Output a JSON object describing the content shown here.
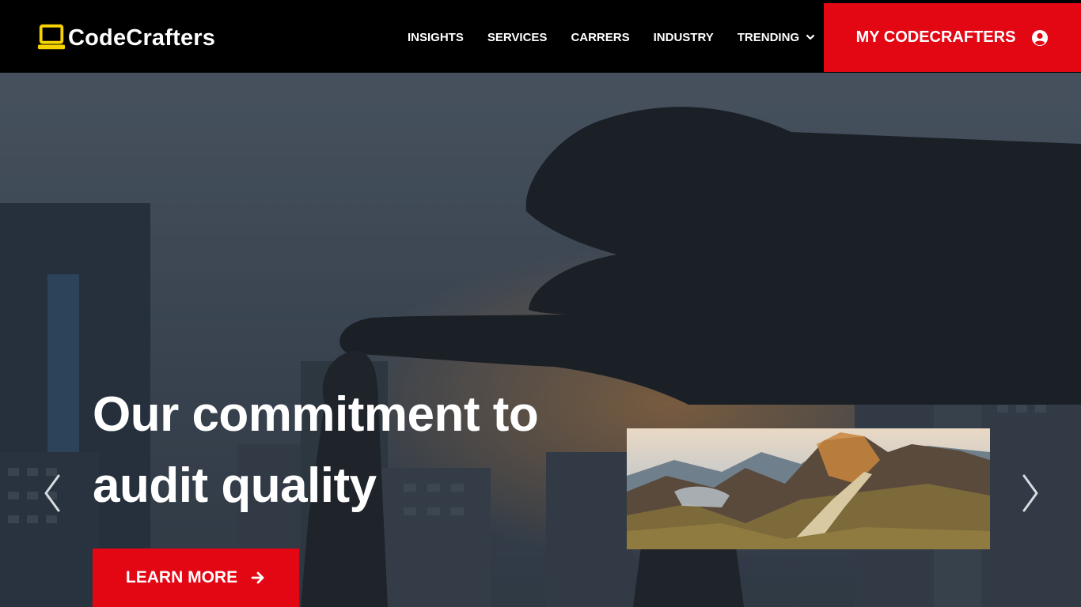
{
  "brand": {
    "name": "CodeCrafters",
    "icon": "laptop-icon",
    "icon_color": "#f5d300"
  },
  "nav": {
    "items": [
      {
        "label": "INSIGHTS"
      },
      {
        "label": "SERVICES"
      },
      {
        "label": "CARRERS"
      },
      {
        "label": "INDUSTRY"
      },
      {
        "label": "TRENDING",
        "icon": "chevron-down-icon"
      }
    ],
    "account": {
      "label": "MY CODECRAFTERS",
      "icon": "user-circle-icon"
    }
  },
  "hero": {
    "headline": "Our commitment to audit quality",
    "cta": {
      "label": "LEARN MORE",
      "icon": "arrow-right-icon"
    },
    "prev_icon": "chevron-left-icon",
    "next_icon": "chevron-right-icon",
    "thumbnail": "mountain-trail-image"
  },
  "colors": {
    "accent": "#e30613",
    "nav_bg": "#000000",
    "text": "#ffffff",
    "logo": "#f5d300"
  }
}
